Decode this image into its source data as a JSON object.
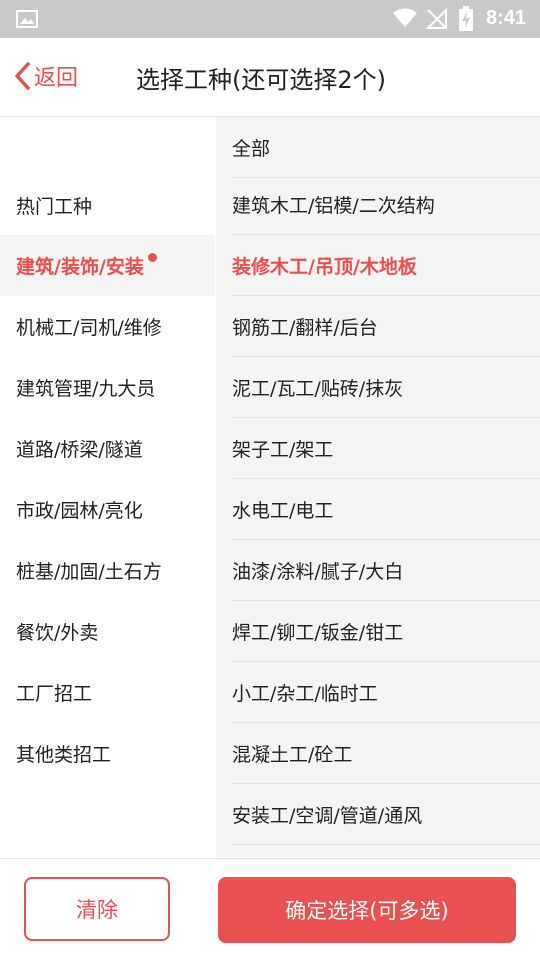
{
  "status": {
    "time": "8:41"
  },
  "header": {
    "back_label": "返回",
    "title": "选择工种(还可选择2个)"
  },
  "left_menu": [
    {
      "label": "热门工种",
      "active": false
    },
    {
      "label": "建筑/装饰/安装",
      "active": true
    },
    {
      "label": "机械工/司机/维修",
      "active": false
    },
    {
      "label": "建筑管理/九大员",
      "active": false
    },
    {
      "label": "道路/桥梁/隧道",
      "active": false
    },
    {
      "label": "市政/园林/亮化",
      "active": false
    },
    {
      "label": "桩基/加固/土石方",
      "active": false
    },
    {
      "label": "餐饮/外卖",
      "active": false
    },
    {
      "label": "工厂招工",
      "active": false
    },
    {
      "label": "其他类招工",
      "active": false
    }
  ],
  "right_list": [
    {
      "label": "全部",
      "selected": false
    },
    {
      "label": "建筑木工/铝模/二次结构",
      "selected": false
    },
    {
      "label": "装修木工/吊顶/木地板",
      "selected": true
    },
    {
      "label": "钢筋工/翻样/后台",
      "selected": false
    },
    {
      "label": "泥工/瓦工/贴砖/抹灰",
      "selected": false
    },
    {
      "label": "架子工/架工",
      "selected": false
    },
    {
      "label": "水电工/电工",
      "selected": false
    },
    {
      "label": "油漆/涂料/腻子/大白",
      "selected": false
    },
    {
      "label": "焊工/铆工/钣金/钳工",
      "selected": false
    },
    {
      "label": "小工/杂工/临时工",
      "selected": false
    },
    {
      "label": "混凝土工/砼工",
      "selected": false
    },
    {
      "label": "安装工/空调/管道/通风",
      "selected": false
    }
  ],
  "buttons": {
    "clear": "清除",
    "confirm": "确定选择(可多选)"
  },
  "colors": {
    "accent": "#ea4f50",
    "status_bar": "#c9c9c9"
  }
}
